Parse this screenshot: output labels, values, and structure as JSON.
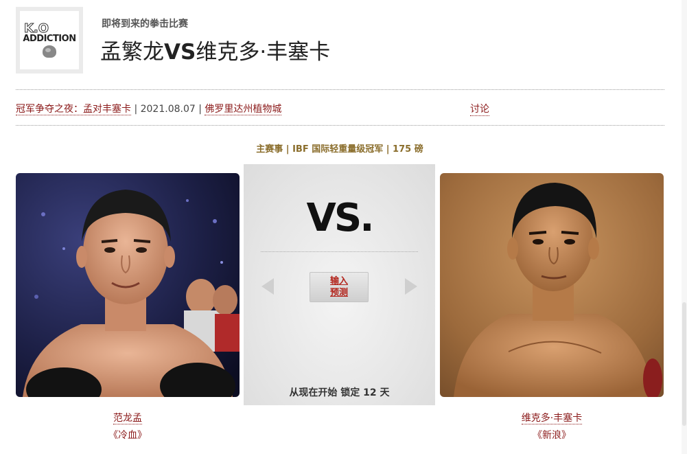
{
  "header": {
    "kicker": "即将到来的拳击比赛",
    "title_a": "孟繁龙",
    "title_vs": "VS",
    "title_b": "维克多·丰塞卡",
    "logo_top": "K.O",
    "logo_word": "ADDICTION"
  },
  "meta": {
    "event_link": "冠军争夺之夜：孟对丰塞卡",
    "date": "| 2021.08.07 |",
    "venue_link": "佛罗里达州植物城",
    "discuss": "讨论"
  },
  "bout": {
    "event_line": "主赛事 | IBF 国际轻重量级冠军 | 175 磅",
    "vs": "VS.",
    "predict_line1": "输入",
    "predict_line2": "预测",
    "lock": "从现在开始 锁定 12 天"
  },
  "fighters": {
    "left": {
      "name": "范龙孟",
      "nickname": "《冷血》"
    },
    "right": {
      "name": "维克多·丰塞卡",
      "nickname": "《新浪》"
    }
  },
  "colors": {
    "link": "#8b1a1a",
    "event_line": "#8a6d2b",
    "button_text": "#b3261e"
  }
}
